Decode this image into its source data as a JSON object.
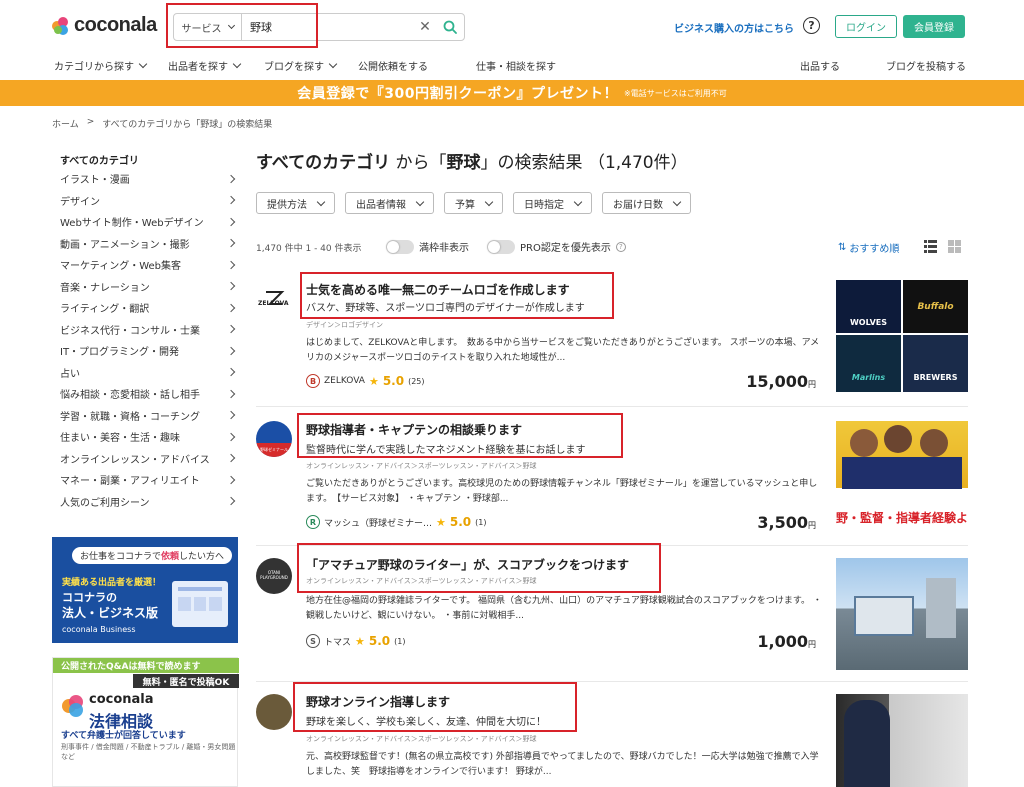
{
  "header": {
    "logo_text": "coconala",
    "search_type": "サービス",
    "search_value": "野球",
    "business_link": "ビジネス購入の方はこちら",
    "help": "?",
    "login": "ログイン",
    "signup": "会員登録"
  },
  "nav": {
    "left": [
      "カテゴリから探す",
      "出品者を探す",
      "ブログを探す",
      "公開依頼をする",
      "仕事・相談を探す"
    ],
    "right": [
      "出品する",
      "ブログを投稿する"
    ]
  },
  "banner": {
    "main": "会員登録で『300円割引クーポン』プレゼント！",
    "note": "※電話サービスはご利用不可"
  },
  "breadcrumb": [
    "ホーム",
    ">",
    "すべてのカテゴリから「野球」の検索結果"
  ],
  "sidebar": {
    "title": "すべてのカテゴリ",
    "items": [
      "イラスト・漫画",
      "デザイン",
      "Webサイト制作・Webデザイン",
      "動画・アニメーション・撮影",
      "マーケティング・Web集客",
      "音楽・ナレーション",
      "ライティング・翻訳",
      "ビジネス代行・コンサル・士業",
      "IT・プログラミング・開発",
      "占い",
      "悩み相談・恋愛相談・話し相手",
      "学習・就職・資格・コーチング",
      "住まい・美容・生活・趣味",
      "オンラインレッスン・アドバイス",
      "マネー・副業・アフィリエイト",
      "人気のご利用シーン"
    ]
  },
  "ad_business": {
    "top_pre": "お仕事をココナラで",
    "top_em": "依頼",
    "top_post": "したい方へ",
    "line1": "実績ある出品者を厳選！",
    "line2": "ココナラの",
    "line3": "法人・ビジネス版",
    "line4": "coconala Business"
  },
  "ad_legal": {
    "bar1": "公開されたQ&Aは無料で読めます",
    "bar2": "無料・匿名で投稿OK",
    "logo": "coconala",
    "name": "法律相談",
    "sub": "すべて弁護士が回答しています",
    "foot": "刑事事件 / 借金問題 / 不動産トラブル / 離婚・男女問題など"
  },
  "results": {
    "title_pre": "すべてのカテゴリ",
    "title_mid": " から「",
    "title_kw": "野球",
    "title_post": "」の検索結果 （1,470件）",
    "filters": [
      "提供方法",
      "出品者情報",
      "予算",
      "日時指定",
      "お届け日数"
    ],
    "count": "1,470 件中 1 - 40 件表示",
    "toggle1": "満枠非表示",
    "toggle2": "PRO認定を優先表示",
    "sort": "おすすめ順"
  },
  "cards": [
    {
      "logo": "ZELKOVA",
      "title": "士気を高める唯一無二のチームロゴを作成します",
      "sub": "バスケ、野球等、スポーツロゴ専門のデザイナーが作成します",
      "category": "デザイン＞ロゴデザイン",
      "desc": "はじめまして、ZELKOVAと申します。　数ある中から当サービスをご覧いただきありがとうございます。 スポーツの本場、アメリカのメジャースポーツロゴのテイストを取り入れた地域性が...",
      "rank": "B",
      "seller": "ZELKOVA",
      "rating": "5.0",
      "reviews": "(25)",
      "price": "15,000",
      "yen": "円",
      "thumb_labels": [
        "WOLVES",
        "Buffalo",
        "Marlins",
        "BREWERS"
      ]
    },
    {
      "logo": "野球ゼミナール",
      "title": "野球指導者・キャプテンの相談乗ります",
      "sub": "監督時代に学んで実践したマネジメント経験を基にお話します",
      "category": "オンラインレッスン・アドバイス＞スポーツレッスン・アドバイス＞野球",
      "desc": "ご覧いただきありがとうございます。高校球児のための野球情報チャンネル「野球ゼミナール」を運営しているマッシュと申します。　【サービス対象】 ・キャプテン ・野球部...",
      "rank": "R",
      "seller": "マッシュ（野球ゼミナー…",
      "rating": "5.0",
      "reviews": "(1)",
      "price": "3,500",
      "yen": "円",
      "thumb_labels": [
        "野・監督・指導者経験よ"
      ]
    },
    {
      "logo": "OTANI PLAYGROUND",
      "title": "「アマチュア野球のライター」が、スコアブックをつけます",
      "sub": "",
      "category": "オンラインレッスン・アドバイス＞スポーツレッスン・アドバイス＞野球",
      "desc": "地方在住@福岡の野球雑誌ライターです。 福岡県（含む九州、山口）のアマチュア野球観戦試合のスコアブックをつけます。 ・観戦したいけど、観にいけない。 ・事前に対戦相手...",
      "rank": "S",
      "seller": "トマス",
      "rating": "5.0",
      "reviews": "(1)",
      "price": "1,000",
      "yen": "円",
      "thumb_labels": []
    },
    {
      "logo": "",
      "title": "野球オンライン指導します",
      "sub": "野球を楽しく、学校も楽しく、友達、仲間を大切に！",
      "category": "オンラインレッスン・アドバイス＞スポーツレッスン・アドバイス＞野球",
      "desc": "元、高校野球監督です！(無名の県立高校です) 外部指導員でやってましたので、野球バカでした！一応大学は勉強で推薦で入学しました、笑　野球指導をオンラインで行います！ 野球が...",
      "rank": "",
      "seller": "",
      "rating": "",
      "reviews": "",
      "price": "",
      "yen": "",
      "thumb_labels": []
    }
  ],
  "colors": {
    "accent_green": "#2fb38f",
    "banner_orange": "#f5a623",
    "link_blue": "#1a6fbf",
    "annotation_red": "#d8232a",
    "star_gold": "#f5b50a"
  }
}
